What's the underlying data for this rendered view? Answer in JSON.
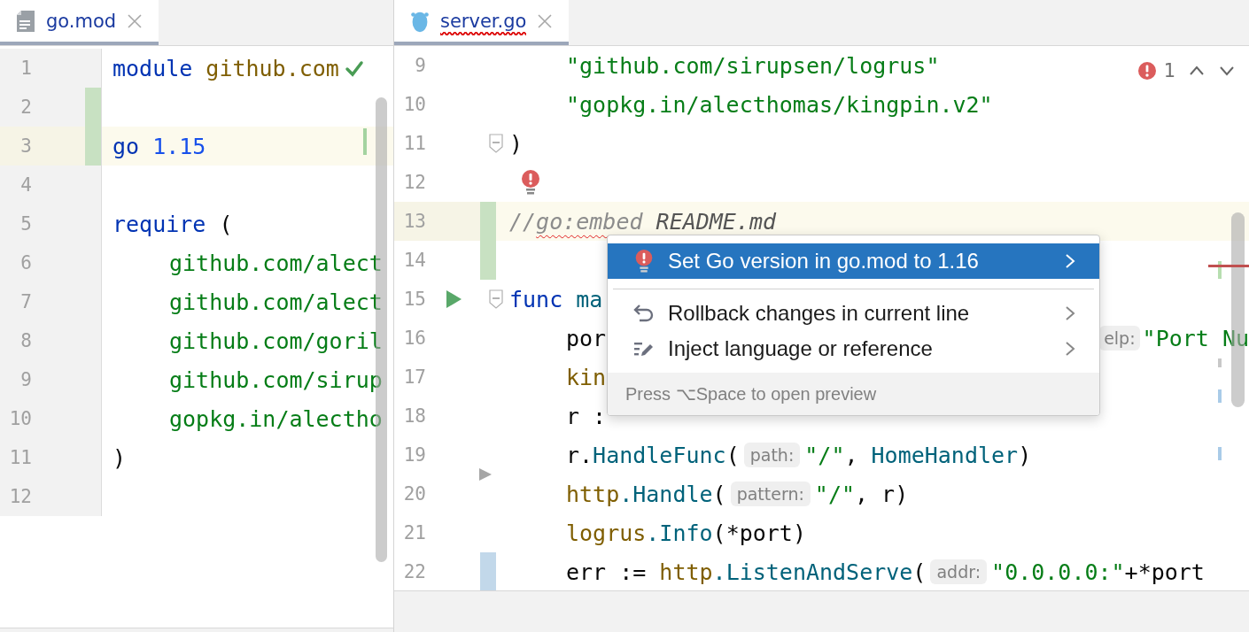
{
  "panes": [
    {
      "tab": {
        "label": "go.mod",
        "kind": "text",
        "selected": true,
        "has_error": false
      },
      "lines": [
        {
          "number": "1",
          "kind": "check",
          "current": false,
          "added": false,
          "modified": false,
          "indented": false,
          "tokens": [
            {
              "text": "module",
              "kind": "kw"
            },
            {
              "text": " github.com",
              "kind": "pkg"
            }
          ]
        },
        {
          "number": "2",
          "kind": "code",
          "current": false,
          "added": true,
          "modified": false
        },
        {
          "number": "3",
          "kind": "code",
          "current": true,
          "added": true,
          "modified": false,
          "indented": false,
          "tokens": [
            {
              "text": "go",
              "kind": "kw"
            },
            {
              "text": " 1.15",
              "kind": "num"
            }
          ]
        },
        {
          "number": "4",
          "kind": "code",
          "current": false,
          "added": false,
          "modified": false
        },
        {
          "number": "5",
          "kind": "code",
          "current": false,
          "added": false,
          "modified": false,
          "indented": false,
          "tokens": [
            {
              "text": "require",
              "kind": "kw"
            },
            {
              "text": " (",
              "kind": "plain"
            }
          ]
        },
        {
          "number": "6",
          "kind": "code",
          "current": false,
          "added": false,
          "modified": false,
          "indented": true,
          "tokens": [
            {
              "text": "github.com/alect",
              "kind": "str"
            }
          ]
        },
        {
          "number": "7",
          "kind": "code",
          "current": false,
          "added": false,
          "modified": false,
          "indented": true,
          "tokens": [
            {
              "text": "github.com/alect",
              "kind": "str"
            }
          ]
        },
        {
          "number": "8",
          "kind": "code",
          "current": false,
          "added": false,
          "modified": false,
          "indented": true,
          "tokens": [
            {
              "text": "github.com/goril",
              "kind": "str"
            }
          ]
        },
        {
          "number": "9",
          "kind": "code",
          "current": false,
          "added": false,
          "modified": false,
          "indented": true,
          "tokens": [
            {
              "text": "github.com/sirup",
              "kind": "str"
            }
          ]
        },
        {
          "number": "10",
          "kind": "code",
          "current": false,
          "added": false,
          "modified": false,
          "indented": true,
          "tokens": [
            {
              "text": "gopkg.in/alectho",
              "kind": "str"
            }
          ]
        },
        {
          "number": "11",
          "kind": "code",
          "current": false,
          "added": false,
          "modified": false,
          "indented": false,
          "tokens": [
            {
              "text": ")",
              "kind": "plain"
            }
          ]
        },
        {
          "number": "12",
          "kind": "code",
          "current": false,
          "added": false,
          "modified": false
        }
      ]
    },
    {
      "tab": {
        "label": "server.go",
        "kind": "go",
        "selected": true,
        "has_error": true
      },
      "inspection": {
        "count": "1"
      },
      "lines": [
        {
          "number": "9",
          "kind": "code",
          "current": false,
          "added": false,
          "modified": false,
          "indented": true,
          "tokens": [
            {
              "text": "\"github.com/sirupsen/logrus\"",
              "kind": "str"
            }
          ]
        },
        {
          "number": "10",
          "kind": "code",
          "current": false,
          "added": false,
          "modified": false,
          "indented": true,
          "tokens": [
            {
              "text": "\"gopkg.in/alecthomas/kingpin.v2\"",
              "kind": "str"
            }
          ]
        },
        {
          "number": "11",
          "kind": "fold",
          "current": false,
          "added": false,
          "modified": false,
          "indented": false,
          "tokens": [
            {
              "text": ")",
              "kind": "plain"
            }
          ]
        },
        {
          "number": "12",
          "kind": "bulb",
          "current": false,
          "added": false,
          "modified": false
        },
        {
          "number": "13",
          "kind": "code",
          "current": true,
          "added": true,
          "modified": false,
          "indented": false,
          "tokens": [
            {
              "text": "//",
              "kind": "comment"
            },
            {
              "text": "go:embed",
              "kind": "directive"
            },
            {
              "text": " README.md",
              "kind": "doc"
            }
          ]
        },
        {
          "number": "14",
          "kind": "code",
          "current": false,
          "added": true,
          "modified": false
        },
        {
          "number": "15",
          "kind": "run-fold",
          "current": false,
          "added": false,
          "modified": false,
          "indented": false,
          "tokens": [
            {
              "text": "func",
              "kind": "kw"
            },
            {
              "text": " ma",
              "kind": "fn"
            }
          ]
        },
        {
          "number": "16",
          "kind": "code",
          "current": false,
          "added": false,
          "modified": false,
          "indented": true,
          "tokens": [
            {
              "text": "por",
              "kind": "plain"
            }
          ],
          "right_tokens": [
            {
              "text": "elp:",
              "kind": "hint"
            },
            {
              "text": "\"Port Nu",
              "kind": "str"
            }
          ]
        },
        {
          "number": "17",
          "kind": "code",
          "current": false,
          "added": false,
          "modified": false,
          "indented": true,
          "tokens": [
            {
              "text": "kin",
              "kind": "pkg"
            }
          ]
        },
        {
          "number": "18",
          "kind": "code",
          "current": false,
          "added": false,
          "modified": false,
          "indented": true,
          "tokens": [
            {
              "text": "r :",
              "kind": "plain"
            }
          ]
        },
        {
          "number": "19",
          "kind": "arrow",
          "current": false,
          "added": false,
          "modified": false,
          "indented": true,
          "tokens": [
            {
              "text": "r.",
              "kind": "plain"
            },
            {
              "text": "HandleFunc",
              "kind": "fn"
            },
            {
              "text": "(",
              "kind": "plain"
            },
            {
              "text": "path:",
              "kind": "hint"
            },
            {
              "text": "\"/\"",
              "kind": "str"
            },
            {
              "text": ", ",
              "kind": "plain"
            },
            {
              "text": "HomeHandler",
              "kind": "fn"
            },
            {
              "text": ")",
              "kind": "plain"
            }
          ]
        },
        {
          "number": "20",
          "kind": "code",
          "current": false,
          "added": false,
          "modified": false,
          "indented": true,
          "tokens": [
            {
              "text": "http",
              "kind": "pkg"
            },
            {
              "text": ".Handle",
              "kind": "fn"
            },
            {
              "text": "(",
              "kind": "plain"
            },
            {
              "text": "pattern:",
              "kind": "hint"
            },
            {
              "text": "\"/\"",
              "kind": "str"
            },
            {
              "text": ", r)",
              "kind": "plain"
            }
          ]
        },
        {
          "number": "21",
          "kind": "code",
          "current": false,
          "added": false,
          "modified": false,
          "indented": true,
          "tokens": [
            {
              "text": "logrus",
              "kind": "pkg"
            },
            {
              "text": ".Info",
              "kind": "fn"
            },
            {
              "text": "(*port)",
              "kind": "plain"
            }
          ]
        },
        {
          "number": "22",
          "kind": "code",
          "current": false,
          "added": false,
          "modified": true,
          "indented": true,
          "tokens": [
            {
              "text": "err := ",
              "kind": "plain"
            },
            {
              "text": "http",
              "kind": "pkg"
            },
            {
              "text": ".ListenAndServe",
              "kind": "fn"
            },
            {
              "text": "(",
              "kind": "plain"
            },
            {
              "text": "addr:",
              "kind": "hint"
            },
            {
              "text": "\"0.0.0.0:\"",
              "kind": "str"
            },
            {
              "text": "+*port",
              "kind": "plain"
            }
          ]
        }
      ]
    }
  ],
  "popup": {
    "items": [
      {
        "label": "Set Go version in go.mod to 1.16",
        "kind": "fix",
        "selected": true,
        "has_submenu": true
      },
      {
        "label": "Rollback changes in current line",
        "kind": "rollback",
        "selected": false,
        "has_submenu": true
      },
      {
        "label": "Inject language or reference",
        "kind": "inject",
        "selected": false,
        "has_submenu": true
      }
    ],
    "footer": "Press ⌥Space to open preview"
  }
}
